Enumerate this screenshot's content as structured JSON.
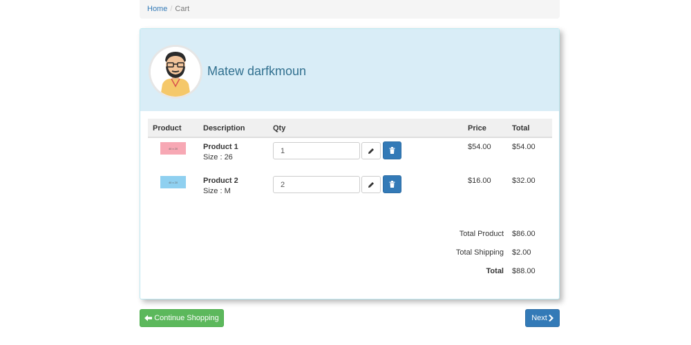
{
  "breadcrumb": {
    "home": "Home",
    "current": "Cart"
  },
  "user": {
    "name": "Matew darfkmoun"
  },
  "table": {
    "headers": {
      "product": "Product",
      "description": "Description",
      "qty": "Qty",
      "price": "Price",
      "total": "Total"
    },
    "rows": [
      {
        "thumb_label": "40 x 20",
        "thumb_color": "#f7a8b4",
        "name": "Product 1",
        "size": "Size : 26",
        "qty": "1",
        "price": "$54.00",
        "total": "$54.00"
      },
      {
        "thumb_label": "40 x 20",
        "thumb_color": "#8fd0f0",
        "name": "Product 2",
        "size": "Size : M",
        "qty": "2",
        "price": "$16.00",
        "total": "$32.00"
      }
    ]
  },
  "summary": {
    "total_product_label": "Total Product",
    "total_product_value": "$86.00",
    "total_shipping_label": "Total Shipping",
    "total_shipping_value": "$2.00",
    "total_label": "Total",
    "total_value": "$88.00"
  },
  "buttons": {
    "continue": "Continue Shopping",
    "next": "Next"
  },
  "icons": {
    "edit": "pencil-icon",
    "delete": "trash-icon",
    "continue": "arrow-left-icon",
    "next": "chevron-right-icon"
  },
  "colors": {
    "panel_head": "#d9edf7",
    "name": "#31708f",
    "success": "#5cb85c",
    "primary": "#337ab7"
  }
}
